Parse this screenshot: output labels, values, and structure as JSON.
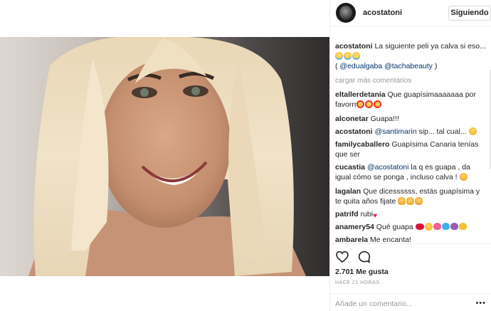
{
  "header": {
    "username": "acostatoni",
    "follow_label": "Siguiendo"
  },
  "caption": {
    "username": "acostatoni",
    "text": "La siguiente peli ya calva si eso...",
    "open_paren": "( ",
    "mention_1": "@edualgaba",
    "mention_2": "@tachabeauty",
    "close_paren": " )"
  },
  "load_more": "cargar más comentarios",
  "comments": [
    {
      "user": "eltallerdetania",
      "text": "Que guapísimaaaaaaa por favorrr"
    },
    {
      "user": "alconetar",
      "text": "Guapa!!!"
    },
    {
      "user": "acostatoni",
      "mention": "@santimarin",
      "text": "sip... tal cual..."
    },
    {
      "user": "familycaballero",
      "text": "Guapísima Canaria tenías que ser"
    },
    {
      "user": "cucastia",
      "mention": "@acostatoni",
      "text": "la q es guapa , da igual cómo se ponga , incluso calva !"
    },
    {
      "user": "lagalan",
      "text": "Que dicessssss, estás guapísima y te quita años fijate"
    },
    {
      "user": "patrifd",
      "text": "rubi"
    },
    {
      "user": "anamery54",
      "text": "Qué guapa"
    },
    {
      "user": "ambarela",
      "text": "Me encanta!"
    }
  ],
  "actions": {
    "likes": "2.701 Me gusta",
    "timestamp": "HACE 21 HORAS",
    "add_comment_placeholder": "Añade un comentario...",
    "more_icon": "•••"
  },
  "icons": {
    "like": "heart-outline-icon",
    "comment": "speech-bubble-icon",
    "more": "ellipsis-icon"
  },
  "colors": {
    "text": "#262626",
    "muted": "#999999",
    "link": "#003569",
    "border": "#efefef"
  }
}
